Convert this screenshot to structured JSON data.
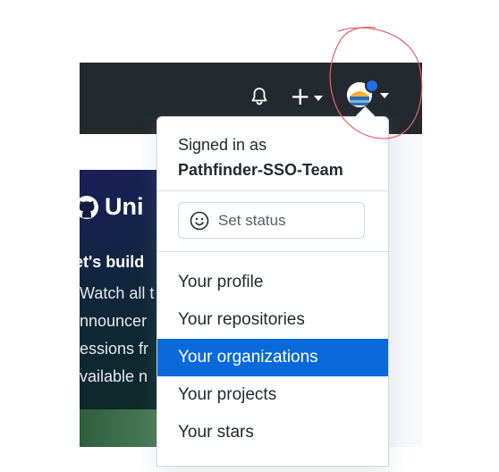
{
  "header": {
    "notifications_icon": "bell-icon",
    "create_icon": "plus-icon",
    "create_symbol": "+",
    "avatar_icon": "user-avatar-icon"
  },
  "banner": {
    "title": "Uni",
    "subtitle": "et's build",
    "lines": [
      "Watch all t",
      "nnouncer",
      "essions fr",
      "vailable n"
    ]
  },
  "dropdown": {
    "signed_in_label": "Signed in as",
    "username": "Pathfinder-SSO-Team",
    "set_status_label": "Set status",
    "items": [
      {
        "label": "Your profile"
      },
      {
        "label": "Your repositories"
      },
      {
        "label": "Your organizations",
        "active": true
      },
      {
        "label": "Your projects"
      },
      {
        "label": "Your stars"
      }
    ]
  },
  "colors": {
    "header_bg": "#24292f",
    "active_item_bg": "#0969da",
    "annotation": "#e0666b"
  }
}
